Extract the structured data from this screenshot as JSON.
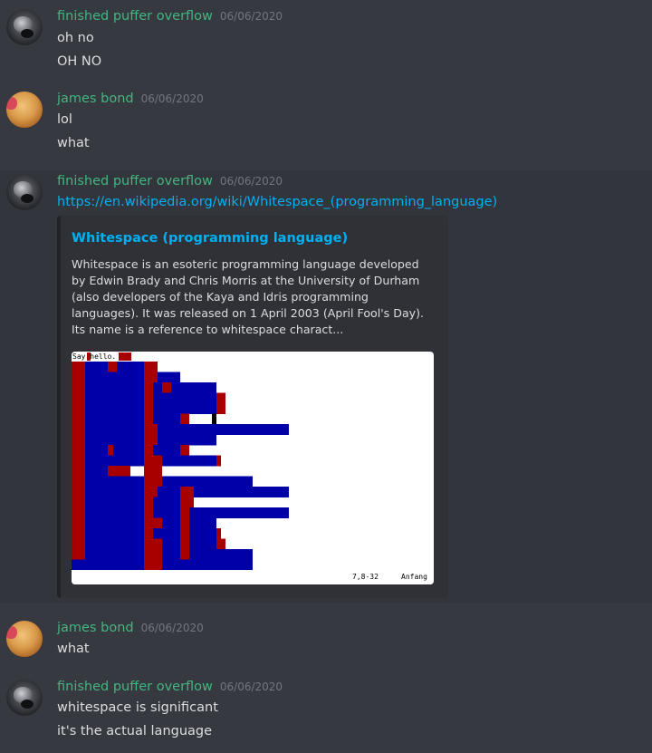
{
  "messages": [
    {
      "author": "finished puffer overflow",
      "timestamp": "06/06/2020",
      "avatar_icon": "puffer-avatar",
      "lines": [
        "oh no",
        "OH NO"
      ]
    },
    {
      "author": "james bond",
      "timestamp": "06/06/2020",
      "avatar_icon": "bread-avatar",
      "lines": [
        "lol",
        "what"
      ]
    },
    {
      "author": "finished puffer overflow",
      "timestamp": "06/06/2020",
      "avatar_icon": "puffer-avatar",
      "link": "https://en.wikipedia.org/wiki/Whitespace_(programming_language)",
      "embed": {
        "title": "Whitespace (programming language)",
        "description": "Whitespace is an esoteric programming language developed by Edwin Brady and Chris Morris at the University of Durham (also developers of the Kaya and Idris programming languages). It was released on 1 April 2003 (April Fool's Day). Its name is a reference to whitespace charact...",
        "image": {
          "top_text": "Say hello.",
          "status_left": "7,8-32",
          "status_right": "Anfang"
        }
      }
    },
    {
      "author": "james bond",
      "timestamp": "06/06/2020",
      "avatar_icon": "bread-avatar",
      "lines": [
        "what"
      ]
    },
    {
      "author": "finished puffer overflow",
      "timestamp": "06/06/2020",
      "avatar_icon": "puffer-avatar",
      "lines": [
        "whitespace is significant",
        "it's the actual language"
      ]
    }
  ],
  "colors": {
    "background": "#36393f",
    "username": "#43b581",
    "link": "#00b0f4",
    "highlight": "#32353b",
    "embed_bg": "#2f3136",
    "space_blue": "#0000a8",
    "tab_red": "#a80000"
  }
}
